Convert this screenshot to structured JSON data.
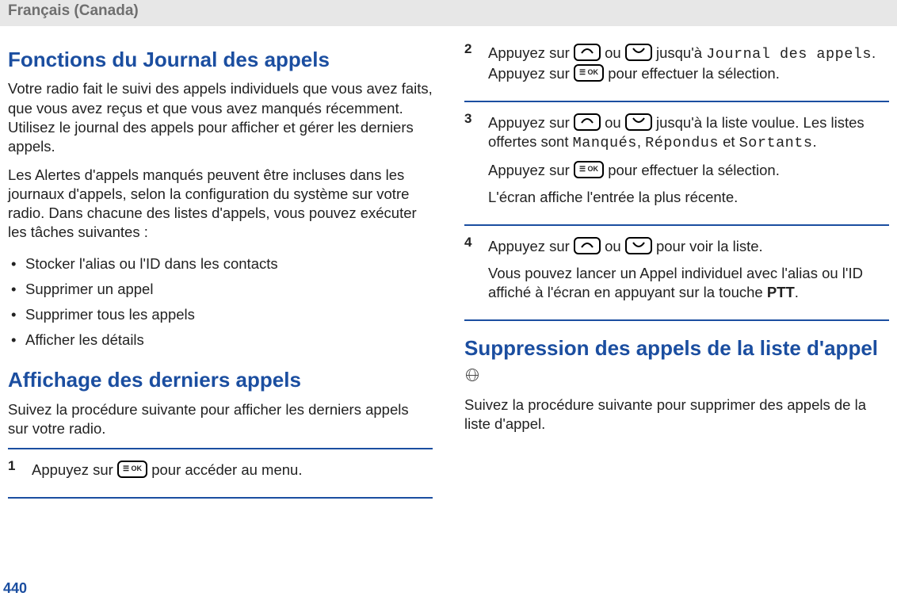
{
  "header": {
    "language": "Français (Canada)"
  },
  "page_number": "440",
  "left": {
    "h1": "Fonctions du Journal des appels",
    "p1": "Votre radio fait le suivi des appels individuels que vous avez faits, que vous avez reçus et que vous avez manqués récemment. Utilisez le journal des appels pour afficher et gérer les derniers appels.",
    "p2": "Les Alertes d'appels manqués peuvent être incluses dans les journaux d'appels, selon la configuration du système sur votre radio. Dans chacune des listes d'appels, vous pouvez exécuter les tâches suivantes :",
    "bullets": [
      "Stocker l'alias ou l'ID dans les contacts",
      "Supprimer un appel",
      "Supprimer tous les appels",
      "Afficher les détails"
    ],
    "h2": "Affichage des derniers appels",
    "p3": "Suivez la procédure suivante pour afficher les derniers appels sur votre radio.",
    "step1": {
      "num": "1",
      "a": "Appuyez sur ",
      "b": " pour accéder au menu."
    }
  },
  "right": {
    "step2": {
      "num": "2",
      "a": "Appuyez sur ",
      "b": " ou ",
      "c": " jusqu'à ",
      "menu1": "Journal des appels",
      "d": ". Appuyez sur ",
      "e": " pour effectuer la sélection."
    },
    "step3": {
      "num": "3",
      "a": "Appuyez sur ",
      "b": " ou ",
      "c": " jusqu'à la liste voulue. Les listes offertes sont ",
      "opt1": "Manqués",
      "sep1": ", ",
      "opt2": "Répondus",
      "sep2": " et ",
      "opt3": "Sortants",
      "d": ".",
      "p2a": "Appuyez sur ",
      "p2b": " pour effectuer la sélection.",
      "p3": "L'écran affiche l'entrée la plus récente."
    },
    "step4": {
      "num": "4",
      "a": "Appuyez sur ",
      "b": " ou ",
      "c": " pour voir la liste.",
      "p2a": "Vous pouvez lancer un Appel individuel avec l'alias ou l'ID affiché à l'écran en appuyant sur la touche ",
      "ptt": "PTT",
      "p2b": "."
    },
    "h3": "Suppression des appels de la liste d'appel ",
    "p4": "Suivez la procédure suivante pour supprimer des appels de la liste d'appel."
  }
}
